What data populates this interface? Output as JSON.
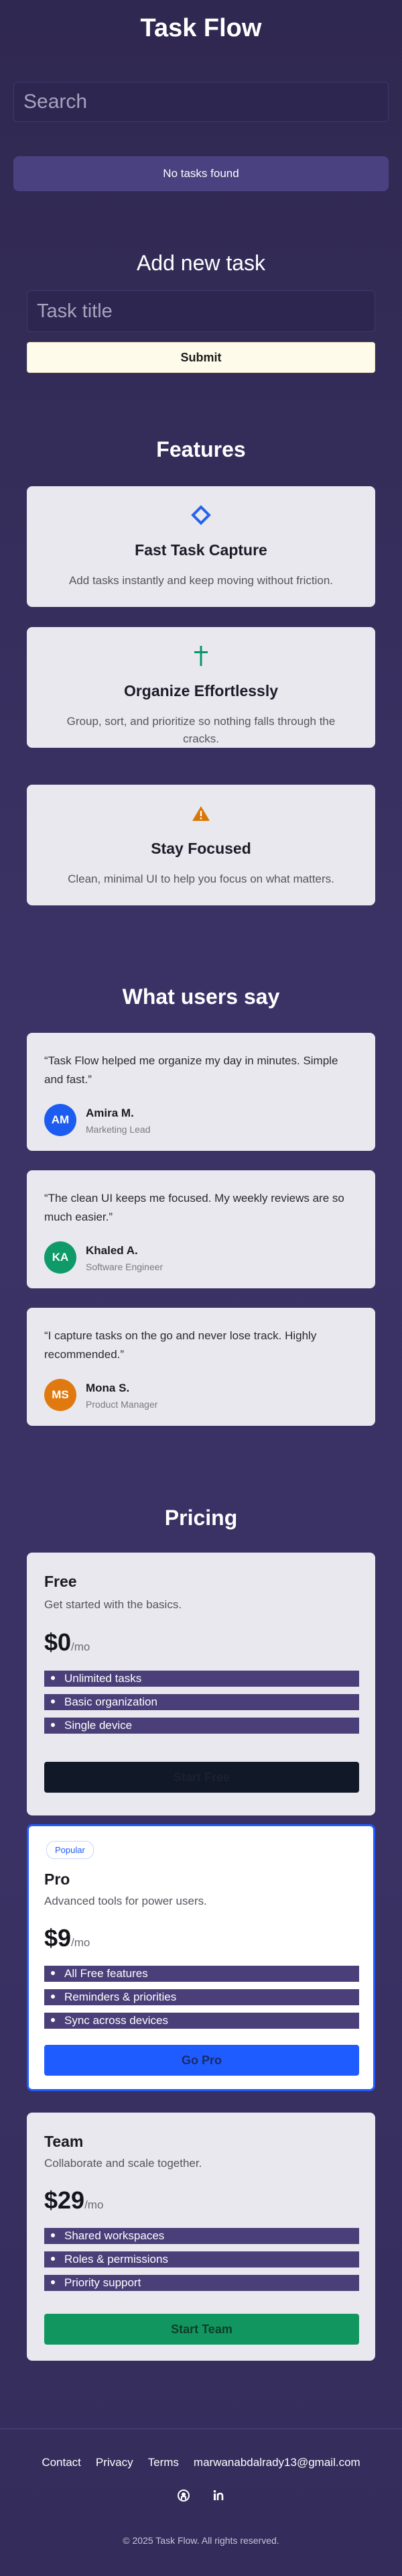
{
  "header": {
    "title": "Task Flow"
  },
  "search": {
    "placeholder": "Search",
    "value": ""
  },
  "tasks": {
    "empty_message": "No tasks found"
  },
  "add_task": {
    "heading": "Add new task",
    "placeholder": "Task title",
    "submit_label": "Submit"
  },
  "features": {
    "heading": "Features",
    "items": [
      {
        "icon": "diamond-icon",
        "icon_color": "#2563eb",
        "title": "Fast Task Capture",
        "text": "Add tasks instantly and keep moving without friction."
      },
      {
        "icon": "cross-icon",
        "icon_color": "#059669",
        "title": "Organize Effortlessly",
        "text": "Group, sort, and prioritize so nothing falls through the cracks."
      },
      {
        "icon": "warning-icon",
        "icon_color": "#d97706",
        "title": "Stay Focused",
        "text": "Clean, minimal UI to help you focus on what matters."
      }
    ]
  },
  "testimonials": {
    "heading": "What users say",
    "items": [
      {
        "quote": "“Task Flow helped me organize my day in minutes. Simple and fast.”",
        "initials": "AM",
        "name": "Amira M.",
        "role": "Marketing Lead",
        "avatar_color": "#1d5cf0"
      },
      {
        "quote": "“The clean UI keeps me focused. My weekly reviews are so much easier.”",
        "initials": "KA",
        "name": "Khaled A.",
        "role": "Software Engineer",
        "avatar_color": "#0f9a6a"
      },
      {
        "quote": "“I capture tasks on the go and never lose track. Highly recommended.”",
        "initials": "MS",
        "name": "Mona S.",
        "role": "Product Manager",
        "avatar_color": "#e07a10"
      }
    ]
  },
  "pricing": {
    "heading": "Pricing",
    "plans": [
      {
        "name": "Free",
        "description": "Get started with the basics.",
        "price": "$0",
        "period": "/mo",
        "features": [
          "Unlimited tasks",
          "Basic organization",
          "Single device"
        ],
        "button_label": "Start Free",
        "button_color": "#111827",
        "button_text_color": "#1b2131"
      },
      {
        "badge": "Popular",
        "name": "Pro",
        "description": "Advanced tools for power users.",
        "price": "$9",
        "period": "/mo",
        "features": [
          "All Free features",
          "Reminders & priorities",
          "Sync across devices"
        ],
        "button_label": "Go Pro",
        "button_color": "#1f5cff",
        "button_text_color": "#1b2a6b"
      },
      {
        "name": "Team",
        "description": "Collaborate and scale together.",
        "price": "$29",
        "period": "/mo",
        "features": [
          "Shared workspaces",
          "Roles & permissions",
          "Priority support"
        ],
        "button_label": "Start Team",
        "button_color": "#12965f",
        "button_text_color": "#0d3d29"
      }
    ]
  },
  "footer": {
    "links": [
      "Contact",
      "Privacy",
      "Terms",
      "marwanabdalrady13@gmail.com"
    ],
    "social": [
      "github-icon",
      "linkedin-icon"
    ],
    "copyright": "© 2025 Task Flow. All rights reserved."
  },
  "colors": {
    "background": "#3a3264",
    "card": "#e9e8ee",
    "feature_bar": "#4a3f78",
    "pro_border": "#1f5cff"
  }
}
